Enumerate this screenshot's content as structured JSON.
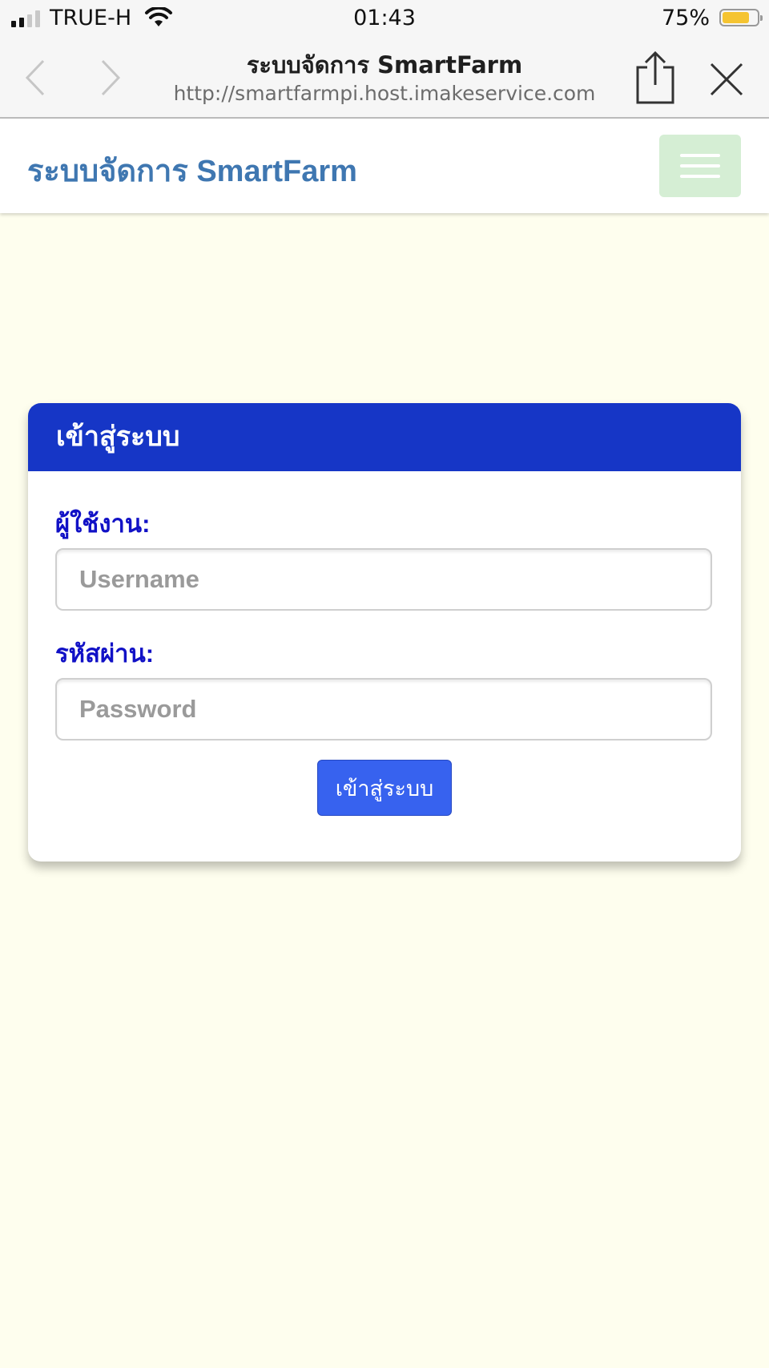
{
  "status_bar": {
    "carrier": "TRUE-H",
    "time": "01:43",
    "battery_percent": "75%",
    "battery_level": 0.75,
    "signal_bars": 2
  },
  "browser": {
    "page_title": "ระบบจัดการ SmartFarm",
    "url": "http://smartfarmpi.host.imakeservice.com"
  },
  "navbar": {
    "brand": "ระบบจัดการ SmartFarm",
    "toggler_color": "#d5eed4"
  },
  "login": {
    "header": "เข้าสู่ระบบ",
    "username_label": "ผู้ใช้งาน:",
    "username_placeholder": "Username",
    "password_label": "รหัสผ่าน:",
    "password_placeholder": "Password",
    "submit_label": "เข้าสู่ระบบ"
  },
  "colors": {
    "background": "#fefeee",
    "header": "#1636c6",
    "label": "#1111c6",
    "button": "#3762ef",
    "brand": "#3f77b1"
  }
}
